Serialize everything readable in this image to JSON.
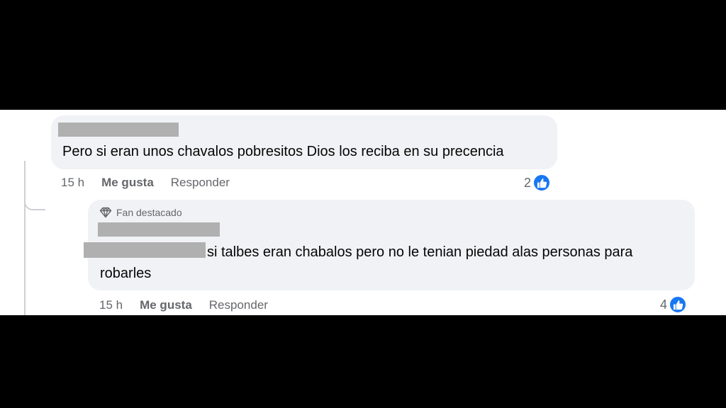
{
  "comment": {
    "author_name": "",
    "text": "Pero si eran unos chavalos pobresitos Dios los reciba en su precencia",
    "time": "15 h",
    "like_label": "Me gusta",
    "reply_label": "Responder",
    "reaction_count": "2",
    "reaction_icon": "thumbs-up-icon"
  },
  "reply": {
    "badge_label": "Fan destacado",
    "badge_icon": "diamond-icon",
    "author_name": "",
    "text_line1": "si talbes eran chabalos pero no le tenian piedad alas personas para",
    "text_line2": "robarles",
    "time": "15 h",
    "like_label": "Me gusta",
    "reply_label": "Responder",
    "reaction_count": "4",
    "reaction_icon": "thumbs-up-icon"
  },
  "colors": {
    "bubble": "#f0f2f5",
    "meta_text": "#65676b",
    "like_blue": "#1877f2",
    "redaction": "#b0b0b0"
  }
}
